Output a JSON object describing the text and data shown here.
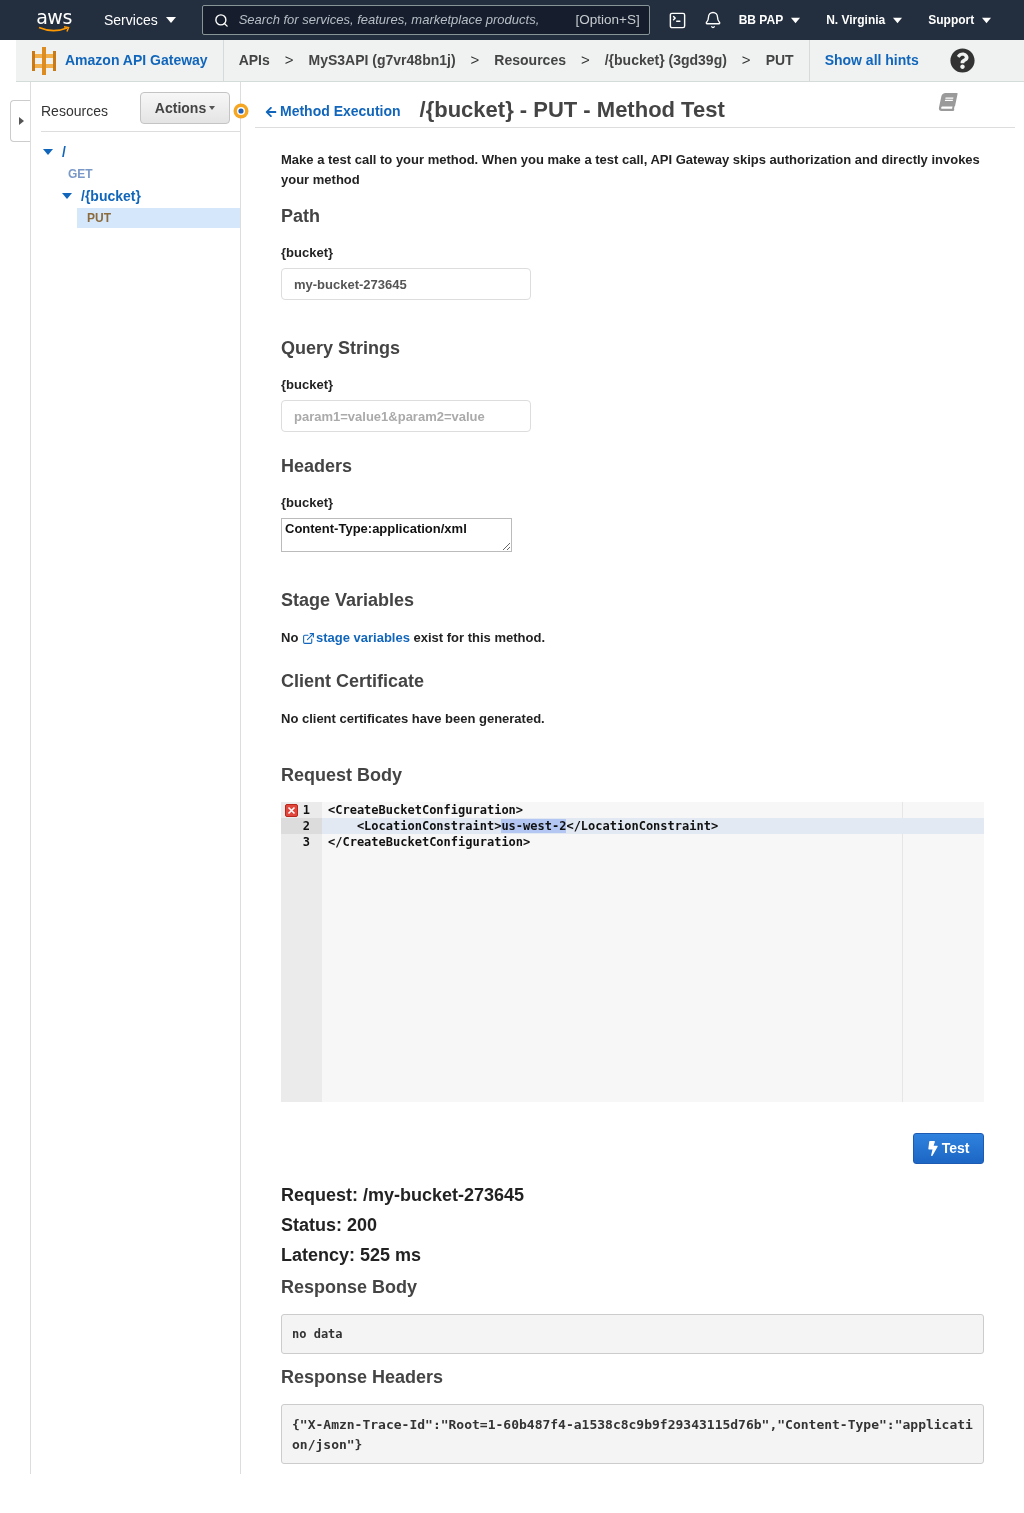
{
  "nav": {
    "logo": "aws",
    "services": "Services",
    "search": {
      "placeholder": "Search for services, features, marketplace products,",
      "shortcut": "[Option+S]"
    },
    "menus": [
      {
        "label": "BB PAP"
      },
      {
        "label": "N. Virginia"
      },
      {
        "label": "Support"
      }
    ]
  },
  "service_bar": {
    "service": "Amazon API Gateway",
    "breadcrumbs": [
      {
        "kind": "link",
        "label": "APIs"
      },
      {
        "kind": "separator",
        "label": ">"
      },
      {
        "kind": "link",
        "label": "MyS3API (g7vr48bn1j)"
      },
      {
        "kind": "separator",
        "label": ">"
      },
      {
        "kind": "link",
        "label": "Resources"
      },
      {
        "kind": "separator",
        "label": ">"
      },
      {
        "kind": "link",
        "label": "/{bucket} (3gd39g)"
      },
      {
        "kind": "separator",
        "label": ">"
      },
      {
        "kind": "link",
        "label": "PUT"
      }
    ],
    "hints_link": "Show all hints"
  },
  "sidebar": {
    "title": "Resources",
    "actions_button": "Actions",
    "tree": [
      {
        "kind": "resource",
        "label": "/",
        "expanded": true,
        "children": [
          {
            "kind": "method",
            "label": "GET",
            "selected": false
          },
          {
            "kind": "resource",
            "label": "/{bucket}",
            "expanded": true,
            "children": [
              {
                "kind": "method",
                "label": "PUT",
                "selected": true
              }
            ]
          }
        ]
      }
    ]
  },
  "header": {
    "back_link": "Method Execution",
    "title": "/{bucket} - PUT - Method Test"
  },
  "intro": "Make a test call to your method. When you make a test call, API Gateway skips authorization and directly invokes your method",
  "path": {
    "heading": "Path",
    "fields": [
      {
        "label": "{bucket}",
        "value": "my-bucket-273645"
      }
    ]
  },
  "query_strings": {
    "heading": "Query Strings",
    "fields": [
      {
        "label": "{bucket}",
        "placeholder": "param1=value1&param2=value"
      }
    ]
  },
  "headers": {
    "heading": "Headers",
    "fields": [
      {
        "label": "{bucket}",
        "value": "Content-Type:application/xml"
      }
    ]
  },
  "stage_variables": {
    "heading": "Stage Variables",
    "note_before": "No",
    "link": "stage variables",
    "note_after": "exist for this method."
  },
  "client_certificate": {
    "heading": "Client Certificate",
    "note": "No client certificates have been generated."
  },
  "request_body": {
    "heading": "Request Body",
    "lines": [
      {
        "number": "1",
        "error": true,
        "active": false,
        "parts": [
          {
            "text": "<CreateBucketConfiguration>",
            "selected": false
          }
        ]
      },
      {
        "number": "2",
        "error": false,
        "active": true,
        "parts": [
          {
            "text": "    <LocationConstraint>",
            "selected": false
          },
          {
            "text": "us-west-2",
            "selected": true
          },
          {
            "text": "</LocationConstraint>",
            "selected": false
          }
        ]
      },
      {
        "number": "3",
        "error": false,
        "active": false,
        "parts": [
          {
            "text": "</CreateBucketConfiguration>",
            "selected": false
          }
        ]
      }
    ]
  },
  "test_button": "Test",
  "result": {
    "lines": [
      "Request: /my-bucket-273645",
      "Status: 200",
      "Latency: 525 ms"
    ],
    "response_body": {
      "heading": "Response Body",
      "content": "no data"
    },
    "response_headers": {
      "heading": "Response Headers",
      "content": "{\"X-Amzn-Trace-Id\":\"Root=1-60b487f4-a1538c8c9b9f29343115d76b\",\"Content-Type\":\"application/json\"}"
    }
  }
}
